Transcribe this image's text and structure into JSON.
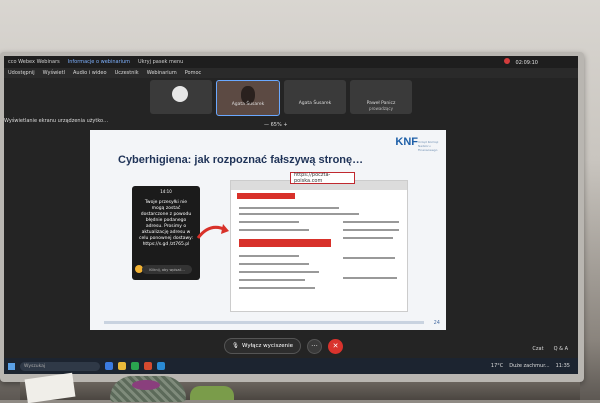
{
  "window": {
    "app_title": "cco Webex Webinars",
    "info_label": "Informacje o webinarium",
    "hide_menu_label": "Ukryj pasek menu",
    "timer": "02:09:10"
  },
  "menu": {
    "items": [
      "Udostępnij",
      "Wyświetl",
      "Audio i wideo",
      "Uczestnik",
      "Webinarium",
      "Pomoc"
    ]
  },
  "share_notice": "Wyświetlanie ekranu urządzenia użytko…",
  "participants": [
    {
      "name": "",
      "role": "",
      "has_video": false
    },
    {
      "name": "Agata Šusarek",
      "role": "",
      "has_video": true
    },
    {
      "name": "Agata Šusarek",
      "role": "",
      "has_video": false
    },
    {
      "name": "Paweł Panicz",
      "role": "prowadzący",
      "has_video": false
    }
  ],
  "zoom": {
    "minus": "—",
    "value": "65%",
    "plus": "+"
  },
  "slide": {
    "logo": "KNF",
    "logo_sub": "Urząd Komisji Nadzoru Finansowego",
    "title": "Cyberhigiena: jak rozpoznać fałszywą stronę…",
    "sms": {
      "time": "14:10",
      "text": "Twoje przesyłki nie mogą zostać dostarczone z powodu błędnie podanego adresu. Prosimy o aktualizację adresu w celu ponownej dostawy: https://s.gd /zt765.pl",
      "reply_placeholder": "Kliknij, aby wpisać..."
    },
    "fake_url": "https://poczta-poiska.com",
    "page_number": "24"
  },
  "controls": {
    "end_label": "Wyłącz wyciszenie",
    "more_label": "···",
    "leave_label": "✕"
  },
  "side_panel": {
    "chat_label": "Czat",
    "qa_label": "Q & A"
  },
  "taskbar": {
    "search_placeholder": "Wyszukaj",
    "weather": "17°C",
    "weather_desc": "Duże zachmur...",
    "clock": "11:35"
  },
  "colors": {
    "accent_red": "#d8312a",
    "knf_blue": "#1d5fa8",
    "slide_title": "#1f3358"
  }
}
